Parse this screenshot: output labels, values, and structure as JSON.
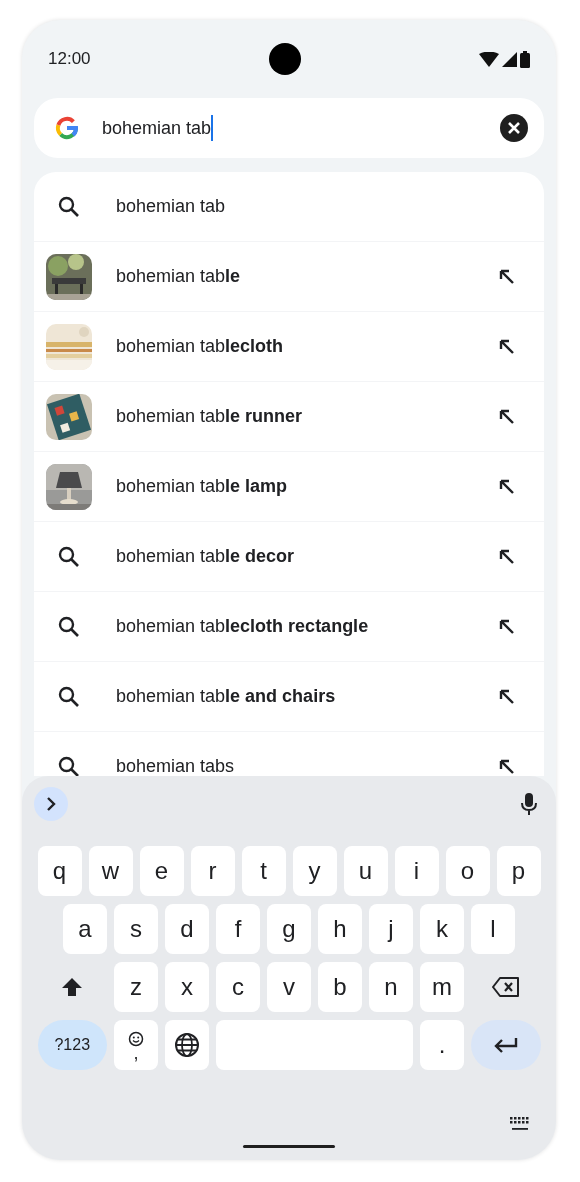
{
  "status_bar": {
    "time": "12:00"
  },
  "search": {
    "value": "bohemian tab"
  },
  "suggestions": [
    {
      "kind": "query",
      "text": "bohemian tab",
      "arrow": false
    },
    {
      "text": "bohemian tab**le**",
      "arrow": true
    },
    {
      "text": "bohemian tab**lecloth**",
      "arrow": true
    },
    {
      "text": "bohemian tab**le runner**",
      "arrow": true
    },
    {
      "text": "bohemian tab**le lamp**",
      "arrow": true
    },
    {
      "kind": "query",
      "text": "bohemian tab**le decor**",
      "arrow": true
    },
    {
      "kind": "query",
      "text": "bohemian tab**lecloth rectangle**",
      "arrow": true
    },
    {
      "kind": "query",
      "text": "bohemian tab**le and chairs**",
      "arrow": true
    },
    {
      "kind": "query",
      "text": "bohemian tabs",
      "arrow": true
    }
  ],
  "keyboard": {
    "top_row": [
      "q",
      "w",
      "e",
      "r",
      "t",
      "y",
      "u",
      "i",
      "o",
      "p"
    ],
    "middle_row": [
      "a",
      "s",
      "d",
      "f",
      "g",
      "h",
      "j",
      "k",
      "l"
    ],
    "bottom_row": [
      "z",
      "x",
      "c",
      "v",
      "b",
      "n",
      "m"
    ],
    "symbols_key": "?123",
    "comma_key": ",",
    "period_key": "."
  }
}
